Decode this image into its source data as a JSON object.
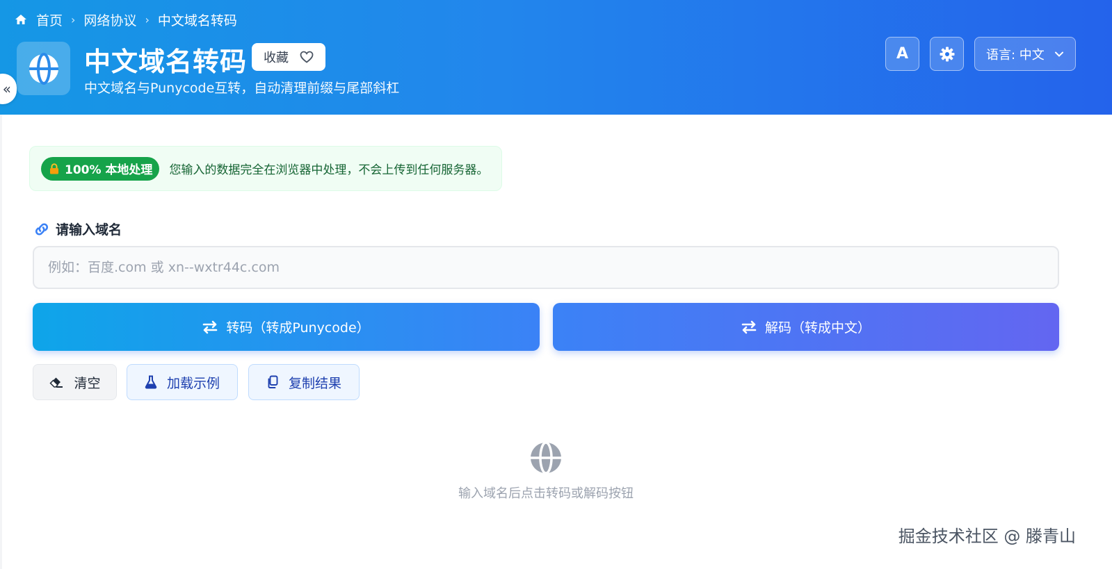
{
  "breadcrumb": {
    "home": "首页",
    "category": "网络协议",
    "current": "中文域名转码"
  },
  "header": {
    "title": "中文域名转码",
    "favorite_label": "收藏",
    "subtitle": "中文域名与Punycode互转，自动清理前缀与尾部斜杠",
    "font_button_label": "A",
    "language_label": "语言: 中文"
  },
  "privacy": {
    "badge": "100% 本地处理",
    "text": "您输入的数据完全在浏览器中处理，不会上传到任何服务器。"
  },
  "input": {
    "label": "请输入域名",
    "placeholder": "例如：百度.com 或 xn--wxtr44c.com",
    "value": ""
  },
  "actions": {
    "encode_label": "转码（转成Punycode）",
    "decode_label": "解码（转成中文）",
    "clear_label": "清空",
    "example_label": "加载示例",
    "copy_label": "复制结果"
  },
  "empty_state": {
    "text": "输入域名后点击转码或解码按钮"
  },
  "watermark": "掘金技术社区 @ 滕青山",
  "icons": {
    "home": "home-icon",
    "globe": "globe-icon",
    "heart": "heart-icon",
    "settings": "gear-icon",
    "chevron": "chevron-down-icon",
    "lock": "lock-icon",
    "link": "link-icon",
    "swap": "swap-icon",
    "eraser": "eraser-icon",
    "flask": "flask-icon",
    "copy": "copy-icon"
  },
  "colors": {
    "header_start": "#1597e5",
    "header_end": "#2463eb",
    "success": "#16a34a",
    "primary": "#3b82f6",
    "indigo": "#6366f1"
  }
}
